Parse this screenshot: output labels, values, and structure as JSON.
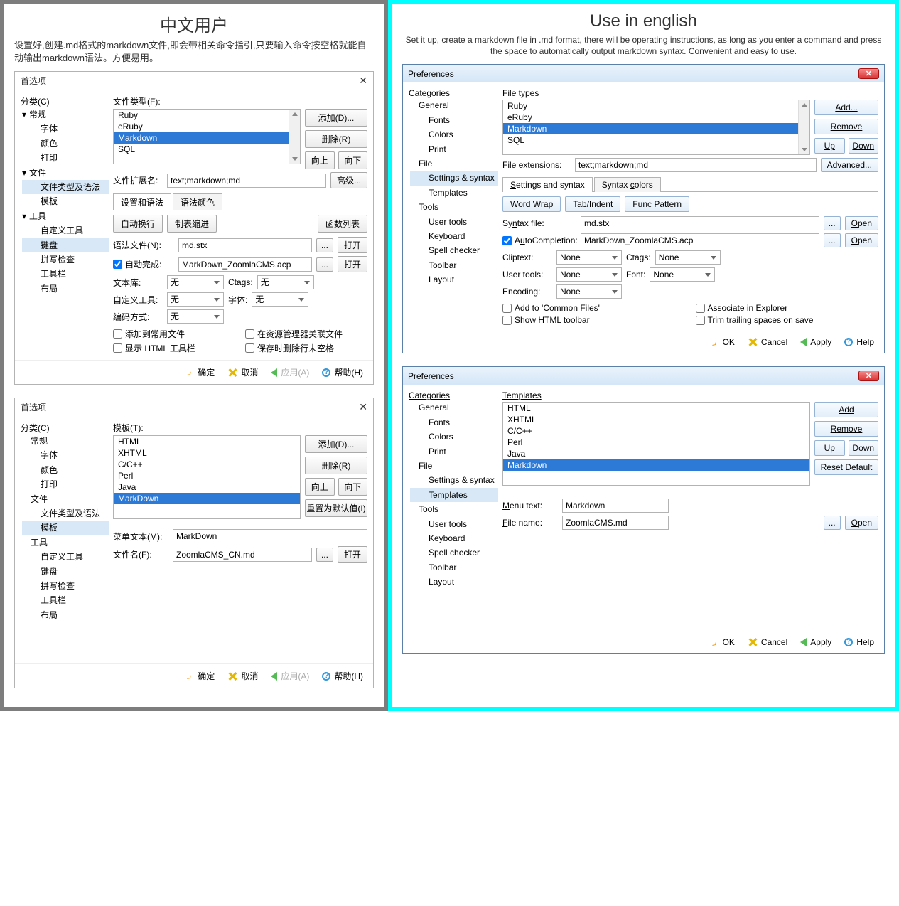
{
  "cn": {
    "title": "中文用户",
    "desc": "设置好,创建.md格式的markdown文件,即会带相关命令指引,只要输入命令按空格就能自动输出markdown语法。方便易用。",
    "dlg_title": "首选项",
    "cat": "分类(C)",
    "tree": {
      "general": "常规",
      "fonts": "字体",
      "colors": "颜色",
      "print": "打印",
      "file": "文件",
      "settings_syntax": "文件类型及语法",
      "templates": "模板",
      "tools": "工具",
      "user_tools": "自定义工具",
      "keyboard": "键盘",
      "spell": "拼写检查",
      "toolbar": "工具栏",
      "layout": "布局"
    },
    "d1": {
      "file_types": "文件类型(F):",
      "list": [
        "Ruby",
        "eRuby",
        "Markdown",
        "SQL"
      ],
      "add": "添加(D)...",
      "remove": "删除(R)",
      "up": "向上",
      "down": "向下",
      "ext_lbl": "文件扩展名:",
      "ext_val": "text;markdown;md",
      "adv": "高级...",
      "tab_sas": "设置和语法",
      "tab_sc": "语法颜色",
      "ww": "自动换行",
      "ti": "制表缩进",
      "fp": "函数列表",
      "sf_lbl": "语法文件(N):",
      "sf_val": "md.stx",
      "open": "打开",
      "ac_lbl": "自动完成:",
      "ac_val": "MarkDown_ZoomlaCMS.acp",
      "clip": "文本库:",
      "ctags": "Ctags:",
      "ut": "自定义工具:",
      "font": "字体:",
      "enc": "编码方式:",
      "none": "无",
      "ck1": "添加到常用文件",
      "ck2": "在资源管理器关联文件",
      "ck3": "显示 HTML 工具栏",
      "ck4": "保存时删除行末空格"
    },
    "d2": {
      "tmpl": "模板(T):",
      "list": [
        "HTML",
        "XHTML",
        "C/C++",
        "Perl",
        "Java",
        "MarkDown"
      ],
      "add": "添加(D)...",
      "remove": "删除(R)",
      "up": "向上",
      "down": "向下",
      "reset": "重置为默认值(I)",
      "menu_lbl": "菜单文本(M):",
      "menu_val": "MarkDown",
      "file_lbl": "文件名(F):",
      "file_val": "ZoomlaCMS_CN.md",
      "open": "打开"
    },
    "foot": {
      "ok": "确定",
      "cancel": "取消",
      "apply": "应用(A)",
      "help": "帮助(H)"
    }
  },
  "en": {
    "title": "Use in english",
    "desc": "Set it up, create a markdown file in .md format, there will be operating instructions, as long as you enter a command and press the space to automatically output markdown syntax. Convenient and easy to use.",
    "dlg_title": "Preferences",
    "cat": "Categories",
    "tree": {
      "general": "General",
      "fonts": "Fonts",
      "colors": "Colors",
      "print": "Print",
      "file": "File",
      "settings_syntax": "Settings & syntax",
      "templates": "Templates",
      "tools": "Tools",
      "user_tools": "User tools",
      "keyboard": "Keyboard",
      "spell": "Spell checker",
      "toolbar": "Toolbar",
      "layout": "Layout"
    },
    "d1": {
      "file_types": "File types",
      "list": [
        "Ruby",
        "eRuby",
        "Markdown",
        "SQL"
      ],
      "add": "Add...",
      "remove": "Remove",
      "up": "Up",
      "down": "Down",
      "ext_lbl": "File extensions:",
      "ext_val": "text;markdown;md",
      "adv": "Advanced...",
      "tab_sas": "Settings and syntax",
      "tab_sc": "Syntax colors",
      "ww": "Word Wrap",
      "ti": "Tab/Indent",
      "fp": "Func Pattern",
      "sf_lbl": "Syntax file:",
      "sf_val": "md.stx",
      "open": "Open",
      "ac_lbl": "AutoCompletion:",
      "ac_val": "MarkDown_ZoomlaCMS.acp",
      "clip": "Cliptext:",
      "ctags": "Ctags:",
      "ut": "User tools:",
      "font": "Font:",
      "enc": "Encoding:",
      "none": "None",
      "ck1": "Add to 'Common Files'",
      "ck2": "Associate in Explorer",
      "ck3": "Show HTML toolbar",
      "ck4": "Trim trailing spaces on save"
    },
    "d2": {
      "tmpl": "Templates",
      "list": [
        "HTML",
        "XHTML",
        "C/C++",
        "Perl",
        "Java",
        "Markdown"
      ],
      "add": "Add",
      "remove": "Remove",
      "up": "Up",
      "down": "Down",
      "reset": "Reset Default",
      "menu_lbl": "Menu text:",
      "menu_val": "Markdown",
      "file_lbl": "File name:",
      "file_val": "ZoomlaCMS.md",
      "open": "Open"
    },
    "foot": {
      "ok": "OK",
      "cancel": "Cancel",
      "apply": "Apply",
      "help": "Help"
    }
  }
}
